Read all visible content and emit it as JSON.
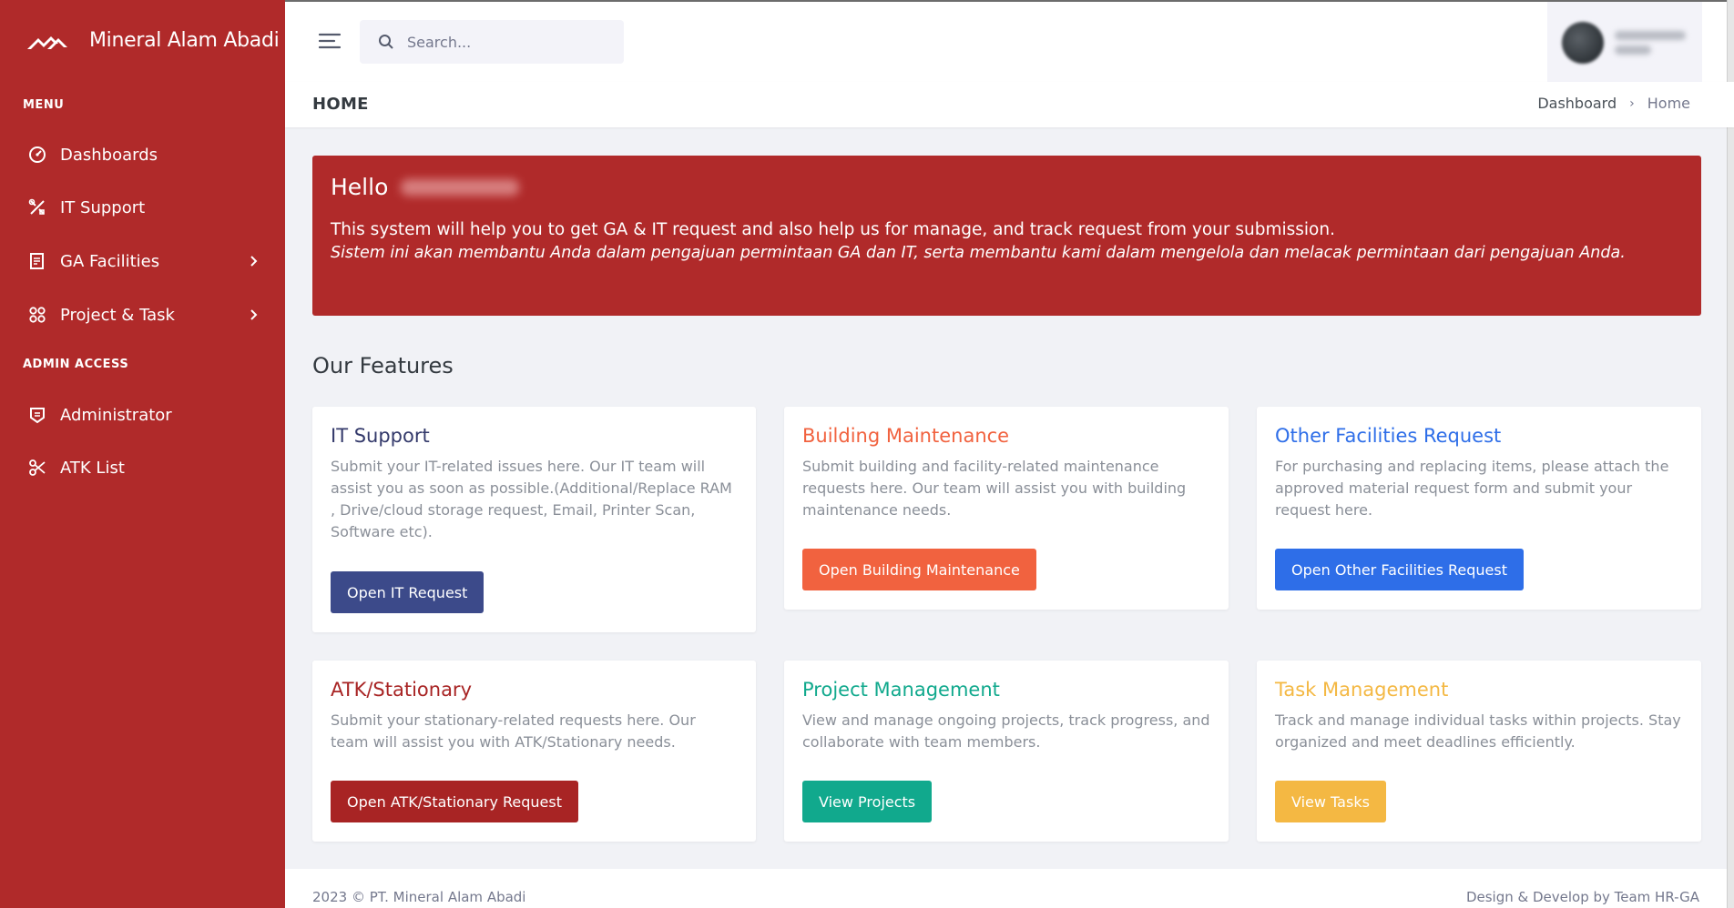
{
  "brand": {
    "name": "Mineral Alam Abadi"
  },
  "sidebar": {
    "sections": [
      {
        "title": "MENU"
      },
      {
        "title": "ADMIN ACCESS"
      }
    ],
    "items": [
      {
        "label": "Dashboards",
        "icon": "dashboard-icon"
      },
      {
        "label": "IT Support",
        "icon": "tools-icon"
      },
      {
        "label": "GA Facilities",
        "icon": "document-icon",
        "has_submenu": true
      },
      {
        "label": "Project & Task",
        "icon": "grid-icon",
        "has_submenu": true
      },
      {
        "label": "Administrator",
        "icon": "admin-icon"
      },
      {
        "label": "ATK List",
        "icon": "scissors-icon"
      }
    ]
  },
  "topbar": {
    "search_placeholder": "Search..."
  },
  "page": {
    "title": "HOME",
    "breadcrumb": [
      "Dashboard",
      "Home"
    ]
  },
  "hello": {
    "greeting": "Hello",
    "text_en": "This system will help you to get GA & IT request and also help us for manage, and track request from your submission.",
    "text_id": "Sistem ini akan membantu Anda dalam pengajuan permintaan GA dan IT, serta membantu kami dalam mengelola dan melacak permintaan dari pengajuan Anda."
  },
  "features": {
    "title": "Our Features",
    "cards": [
      {
        "title": "IT Support",
        "text": "Submit your IT-related issues here. Our IT team will assist you as soon as possible.(Additional/Replace RAM , Drive/cloud storage request, Email, Printer Scan, Software etc).",
        "button": "Open IT Request",
        "color": "#3c4a8a",
        "title_color": "#343a6b"
      },
      {
        "title": "Building Maintenance",
        "text": "Submit building and facility-related maintenance requests here. Our team will assist you with building maintenance needs.",
        "button": "Open Building Maintenance",
        "color": "#f1623f",
        "title_color": "#f1623f"
      },
      {
        "title": "Other Facilities Request",
        "text": "For purchasing and replacing items, please attach the approved material request form and submit your request here.",
        "button": "Open Other Facilities Request",
        "color": "#2e6ee8",
        "title_color": "#2e6ee8"
      },
      {
        "title": "ATK/Stationary",
        "text": "Submit your stationary-related requests here. Our team will assist you with ATK/Stationary needs.",
        "button": "Open ATK/Stationary Request",
        "color": "#a82424",
        "title_color": "#a82424"
      },
      {
        "title": "Project Management",
        "text": "View and manage ongoing projects, track progress, and collaborate with team members.",
        "button": "View Projects",
        "color": "#11a98d",
        "title_color": "#11a98d"
      },
      {
        "title": "Task Management",
        "text": "Track and manage individual tasks within projects. Stay organized and meet deadlines efficiently.",
        "button": "View Tasks",
        "color": "#f4b843",
        "title_color": "#f4b843"
      }
    ]
  },
  "footer": {
    "left": "2023 © PT. Mineral Alam Abadi",
    "right": "Design & Develop by Team HR-GA"
  },
  "colors": {
    "sidebar": "#b02a2a",
    "banner": "#b02a2a"
  }
}
